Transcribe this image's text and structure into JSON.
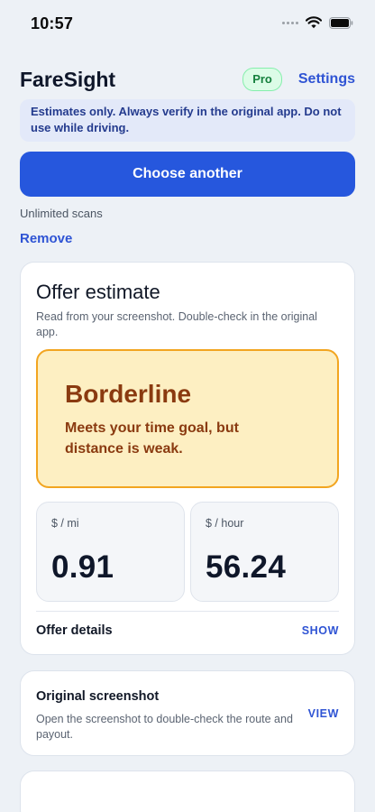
{
  "status_bar": {
    "time": "10:57"
  },
  "header": {
    "title": "FareSight",
    "badge": "Pro",
    "settings_label": "Settings"
  },
  "disclaimer": {
    "text": "Estimates only. Always verify in the original app. Do not use while driving."
  },
  "actions": {
    "choose_label": "Choose another",
    "scans_text": "Unlimited scans",
    "remove_label": "Remove"
  },
  "offer": {
    "title": "Offer estimate",
    "subtitle": "Read from your screenshot. Double-check in the original app.",
    "verdict": {
      "title": "Borderline",
      "description": "Meets your time goal, but distance is weak."
    },
    "metrics": [
      {
        "label": "$ / mi",
        "value": "0.91"
      },
      {
        "label": "$ / hour",
        "value": "56.24"
      }
    ],
    "details_label": "Offer details",
    "details_action": "SHOW"
  },
  "screenshot": {
    "title": "Original screenshot",
    "description": "Open the screenshot to double-check the route and payout.",
    "action": "VIEW"
  },
  "colors": {
    "primary": "#2657dd",
    "link": "#2f54d4",
    "verdict_bg": "#fdefc2",
    "verdict_border": "#f2a520",
    "verdict_text": "#8a3a10",
    "pro_green": "#15803d"
  },
  "icons": [
    "cellular-signal-icon",
    "wifi-icon",
    "battery-icon"
  ]
}
